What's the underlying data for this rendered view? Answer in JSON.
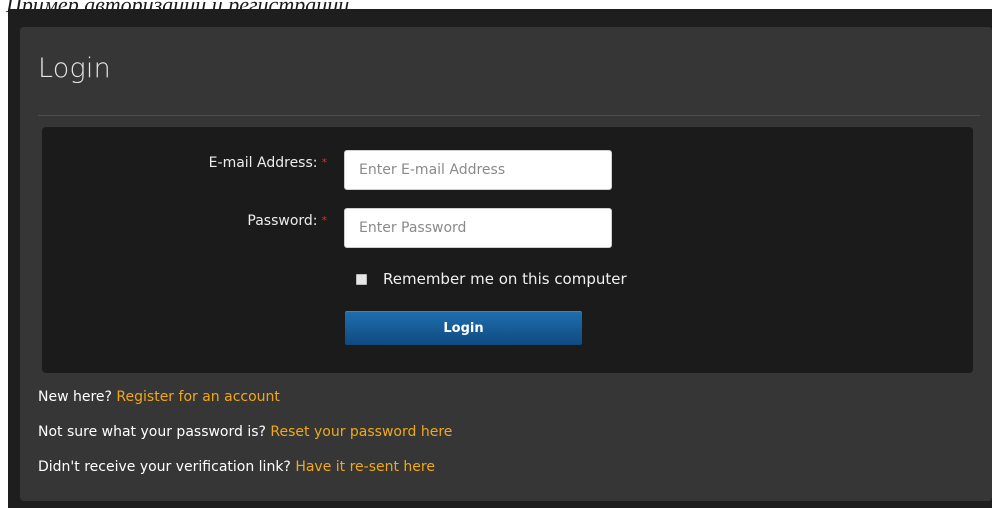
{
  "caption": "Пример авторизации и регистрации",
  "panel": {
    "title": "Login"
  },
  "form": {
    "email": {
      "label": "E-mail Address:",
      "required_mark": "*",
      "placeholder": "Enter E-mail Address",
      "value": ""
    },
    "password": {
      "label": "Password:",
      "required_mark": "*",
      "placeholder": "Enter Password",
      "value": ""
    },
    "remember": {
      "label": "Remember me on this computer",
      "checked": false
    },
    "submit_label": "Login"
  },
  "links": [
    {
      "prefix": "New here?",
      "link_text": "Register for an account"
    },
    {
      "prefix": "Not sure what your password is?",
      "link_text": "Reset your password here"
    },
    {
      "prefix": "Didn't receive your verification link?",
      "link_text": "Have it re-sent here"
    }
  ],
  "colors": {
    "background": "#1e1e1e",
    "panel": "#363636",
    "form_box": "#1b1b1b",
    "link": "#f0a818",
    "required": "#c0392b",
    "button": "#1a5e9a"
  }
}
